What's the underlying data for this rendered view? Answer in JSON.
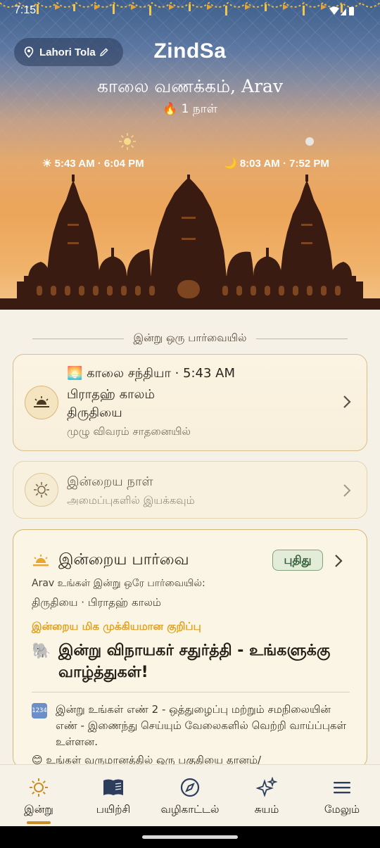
{
  "status_bar": {
    "time": "7:15"
  },
  "header": {
    "location": "Lahori Tola",
    "app_title": "ZindSa",
    "greeting": "காலை வணக்கம், Arav",
    "streak": "🔥 1 நாள்",
    "sun_times": "☀ 5:43 AM · 6:04 PM",
    "moon_times": "🌙 8:03 AM · 7:52 PM"
  },
  "section": {
    "heading": "இன்று ஒரு பார்வையில்"
  },
  "sandhya_card": {
    "title": "🌅 காலை சந்தியா · 5:43 AM",
    "line2": "பிராதஹ் காலம்",
    "line3": "திருதியை",
    "line4": "முழு விவரம் சாதனையில்"
  },
  "day_card": {
    "title": "இன்றைய நாள்",
    "subtitle": "அமைப்புகளில் இயக்கவும்"
  },
  "overview_card": {
    "title": "இன்றைய பார்வை",
    "badge": "புதிது",
    "subtitle": "Arav உங்கள் இன்று ஒரே பார்வையில்:",
    "subtitle2": "திருதியை · பிராதஹ் காலம்",
    "label": "இன்றைய மிக முக்கியமான குறிப்பு",
    "highlight_icon": "🐘",
    "highlight": "இன்று விநாயகர் சதுர்த்தி - உங்களுக்கு வாழ்த்துகள்!",
    "number_icon": "1234",
    "number_text": "இன்று உங்கள் எண் 2 - ஒத்துழைப்பு மற்றும் சமநிலையின் எண் - இணைந்து செய்யும் வேலைகளில் வெற்றி வாய்ப்புகள் உள்ளன.",
    "next_text": "😊 உங்கள் வருமானத்தில் ஒரு பகுதியை தானம்/"
  },
  "bottom_nav": {
    "items": [
      {
        "label": "இன்று",
        "icon": "sun-icon",
        "active": true
      },
      {
        "label": "பயிற்சி",
        "icon": "book-icon",
        "active": false
      },
      {
        "label": "வழிகாட்டல்",
        "icon": "compass-icon",
        "active": false
      },
      {
        "label": "சுயம்",
        "icon": "sparkle-icon",
        "active": false
      },
      {
        "label": "மேலும்",
        "icon": "menu-icon",
        "active": false
      }
    ]
  },
  "colors": {
    "accent": "#c98e24",
    "highlight_label": "#e0a01e",
    "badge_bg": "#e3ecd8",
    "badge_text": "#2d5a36"
  }
}
